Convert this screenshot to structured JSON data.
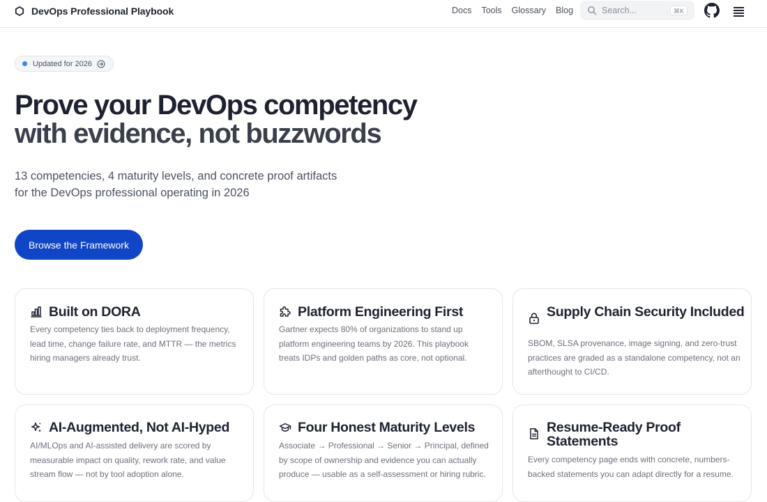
{
  "header": {
    "title": "DevOps Professional Playbook",
    "nav": [
      "Docs",
      "Tools",
      "Glossary",
      "Blog"
    ],
    "search": {
      "placeholder": "Search...",
      "shortcut": "⌘K"
    }
  },
  "hero": {
    "badge": "Updated for 2026",
    "headline_strong": "Prove your DevOps competency",
    "headline_line2": "with evidence, not buzzwords",
    "subhead_line1": "13 competencies, 4 maturity levels, and concrete proof artifacts",
    "subhead_line2": "for the DevOps professional operating in 2026",
    "cta": "Browse the Framework"
  },
  "cards": [
    {
      "title": "Built on DORA",
      "icon": "bar-chart-icon",
      "body": "Every competency ties back to deployment frequency, lead time, change failure rate, and MTTR — the metrics hiring managers already trust."
    },
    {
      "title": "Platform Engineering First",
      "icon": "puzzle-icon",
      "body": "Gartner expects 80% of organizations to stand up platform engineering teams by 2026. This playbook treats IDPs and golden paths as core, not optional."
    },
    {
      "title": "Supply Chain Security Included",
      "icon": "lock-icon",
      "body": "SBOM, SLSA provenance, image signing, and zero-trust practices are graded as a standalone competency, not an afterthought to CI/CD."
    },
    {
      "title": "AI-Augmented, Not AI-Hyped",
      "icon": "sparkles-icon",
      "body": "AI/MLOps and AI-assisted delivery are scored by measurable impact on quality, rework rate, and value stream flow — not by tool adoption alone."
    },
    {
      "title": "Four Honest Maturity Levels",
      "icon": "graduation-cap-icon",
      "body": "Associate → Professional → Senior → Principal, defined by scope of ownership and evidence you can actually produce — usable as a self-assessment or hiring rubric."
    },
    {
      "title": "Resume-Ready Proof Statements",
      "icon": "document-icon",
      "body": "Every competency page ends with concrete, numbers-backed statements you can adapt directly for a resume."
    }
  ],
  "colors": {
    "accent": "#1046c6",
    "badge_dot": "#3b82f6",
    "text": "#1e2230"
  }
}
